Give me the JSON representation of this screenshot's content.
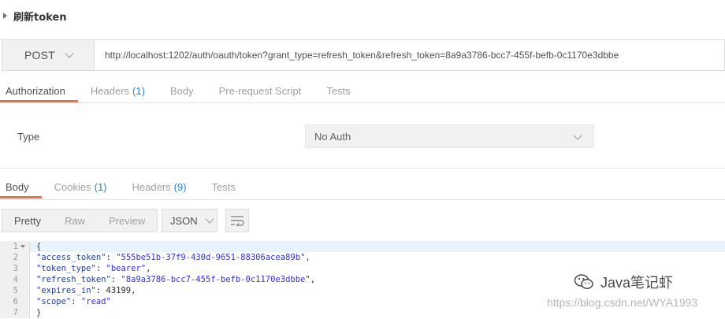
{
  "request": {
    "name": "刷新token",
    "method": "POST",
    "url": "http://localhost:1202/auth/oauth/token?grant_type=refresh_token&refresh_token=8a9a3786-bcc7-455f-befb-0c1170e3dbbe"
  },
  "request_tabs": [
    {
      "label": "Authorization",
      "count": ""
    },
    {
      "label": "Headers",
      "count": "(1)"
    },
    {
      "label": "Body",
      "count": ""
    },
    {
      "label": "Pre-request Script",
      "count": ""
    },
    {
      "label": "Tests",
      "count": ""
    }
  ],
  "auth": {
    "type_label": "Type",
    "type_value": "No Auth"
  },
  "response_tabs": [
    {
      "label": "Body",
      "count": ""
    },
    {
      "label": "Cookies",
      "count": "(1)"
    },
    {
      "label": "Headers",
      "count": "(9)"
    },
    {
      "label": "Tests",
      "count": ""
    }
  ],
  "view_modes": [
    "Pretty",
    "Raw",
    "Preview"
  ],
  "format": "JSON",
  "code_lines": [
    {
      "n": "1",
      "text": "{"
    },
    {
      "n": "2",
      "key": "\"access_token\"",
      "value": "\"555be51b-37f9-430d-9651-88306acea89b\"",
      "end": ","
    },
    {
      "n": "3",
      "key": "\"token_type\"",
      "value": "\"bearer\"",
      "end": ","
    },
    {
      "n": "4",
      "key": "\"refresh_token\"",
      "value": "\"8a9a3786-bcc7-455f-befb-0c1170e3dbbe\"",
      "end": ","
    },
    {
      "n": "5",
      "key": "\"expires_in\"",
      "value": "43199",
      "end": ","
    },
    {
      "n": "6",
      "key": "\"scope\"",
      "value": "\"read\"",
      "end": ""
    },
    {
      "n": "7",
      "text": "}"
    }
  ],
  "watermark": {
    "brand": "Java笔记虾",
    "url": "https://blog.csdn.net/WYA1993"
  },
  "colors": {
    "accent": "#f26b3a",
    "count": "#2a83c5"
  }
}
